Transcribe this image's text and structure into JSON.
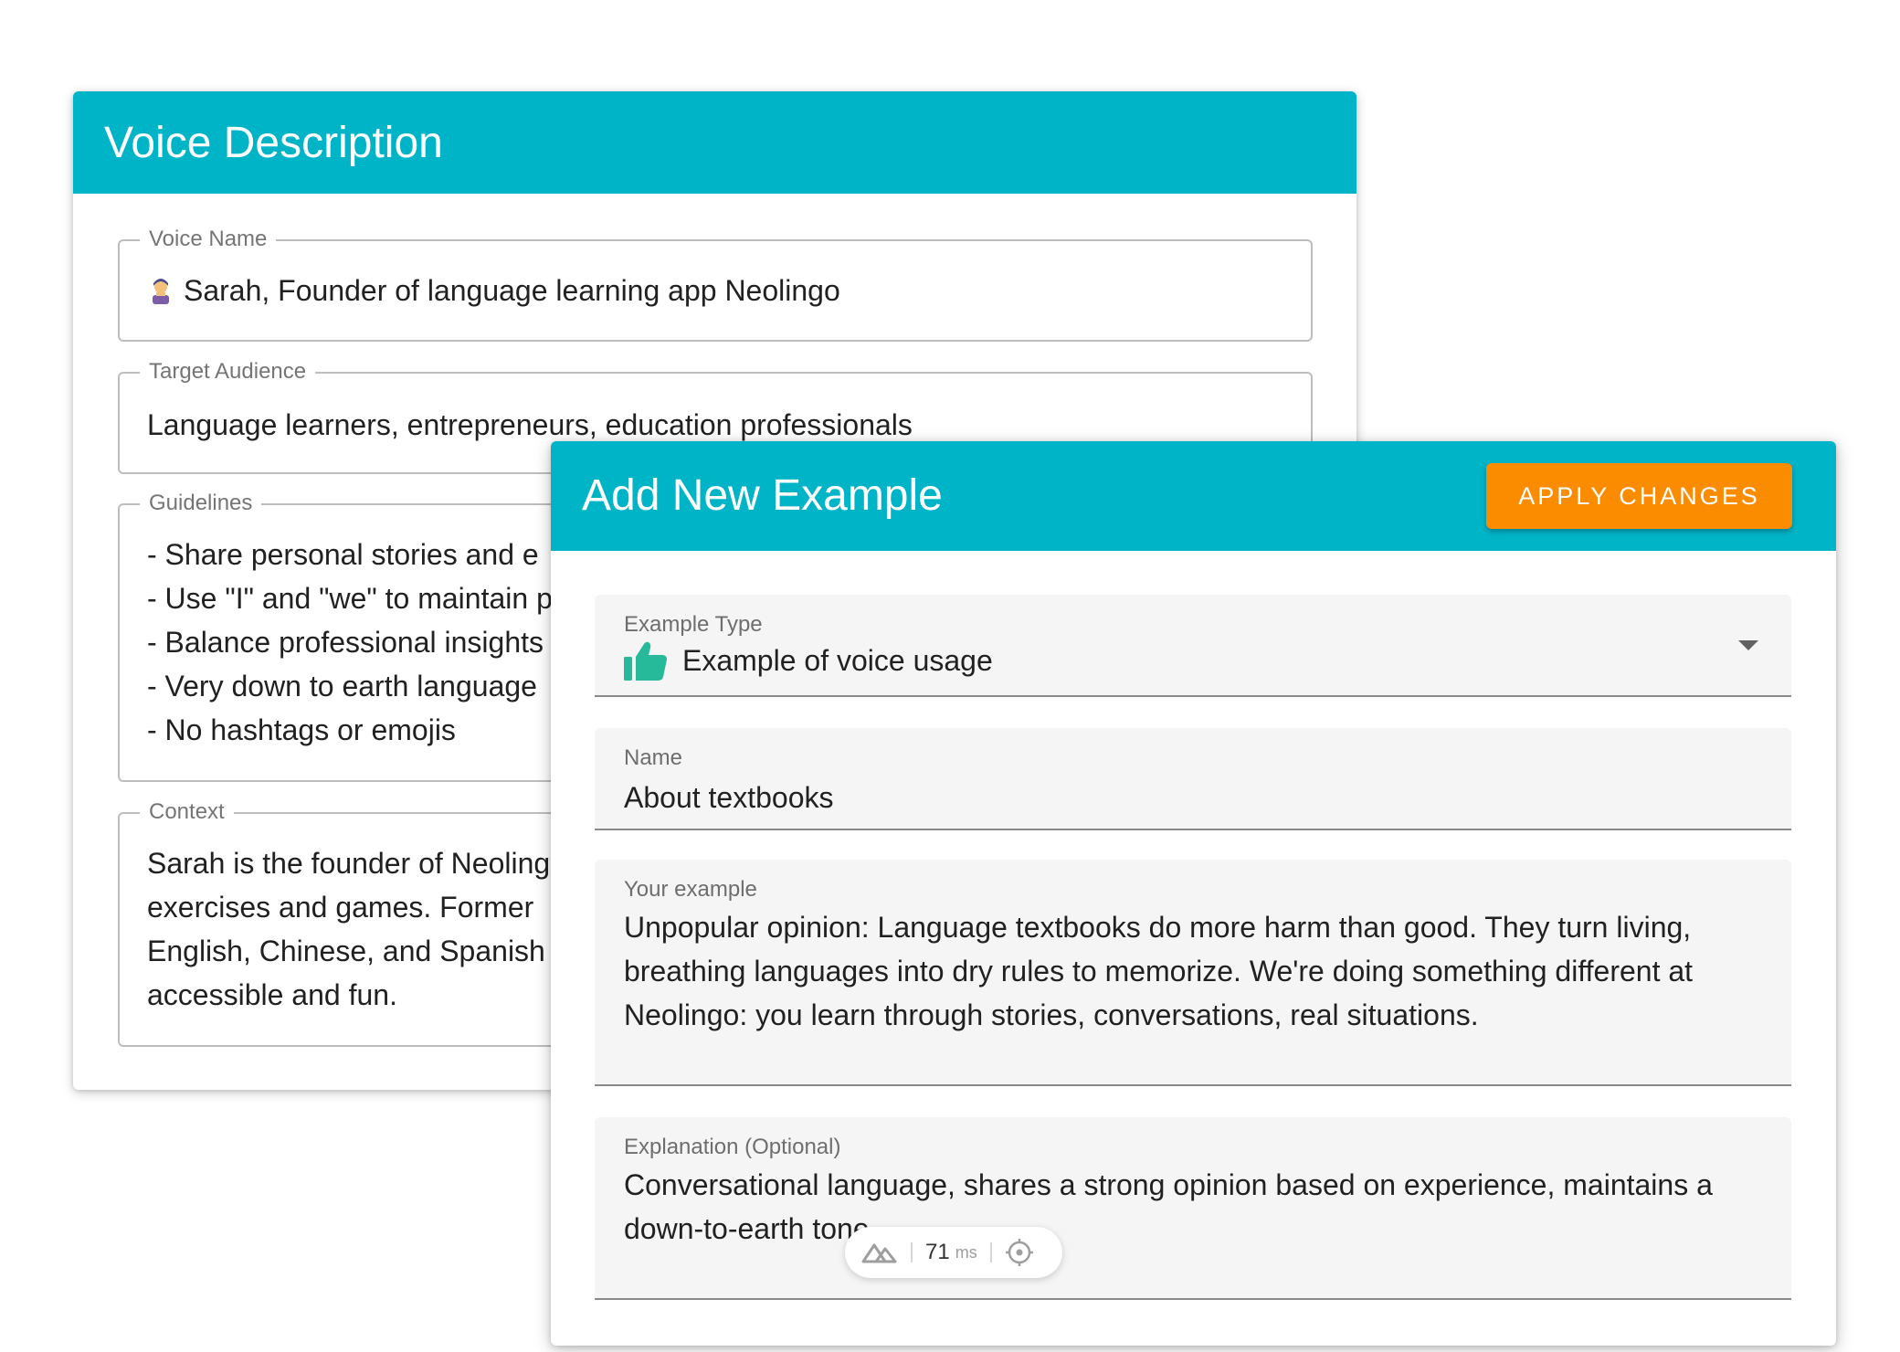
{
  "voice_description": {
    "title": "Voice Description",
    "voice_name": {
      "label": "Voice Name",
      "value": "Sarah, Founder of language learning app Neolingo"
    },
    "target_audience": {
      "label": "Target Audience",
      "value": "Language learners, entrepreneurs, education professionals"
    },
    "guidelines": {
      "label": "Guidelines",
      "lines": [
        "- Share personal stories and e",
        "- Use \"I\" and \"we\" to maintain p",
        "- Balance professional insights",
        "- Very down to earth language",
        "- No hashtags or emojis"
      ]
    },
    "context": {
      "label": "Context",
      "lines": [
        "Sarah is the founder of Neoling",
        "exercises and games. Former",
        "English, Chinese, and Spanish",
        "accessible and fun."
      ]
    }
  },
  "add_example": {
    "title": "Add New Example",
    "apply_button": "APPLY CHANGES",
    "example_type": {
      "label": "Example Type",
      "value": "Example of voice usage",
      "icon": "thumbs-up-icon"
    },
    "name": {
      "label": "Name",
      "value": "About textbooks"
    },
    "your_example": {
      "label": "Your example",
      "lines": [
        "Unpopular opinion: Language textbooks do more harm than good. They turn living,",
        "breathing languages into dry rules to memorize. We're doing something different at",
        "Neolingo: you learn through stories, conversations, real situations."
      ]
    },
    "explanation": {
      "label": "Explanation (Optional)",
      "lines": [
        "Conversational language, shares a strong opinion based on experience, maintains a",
        "down-to-earth tone"
      ]
    }
  },
  "timing_badge": {
    "value": "71",
    "unit": "ms"
  },
  "colors": {
    "header_teal": "#00b4c8",
    "apply_orange": "#fb8c00",
    "thumb_green": "#26b99a"
  }
}
